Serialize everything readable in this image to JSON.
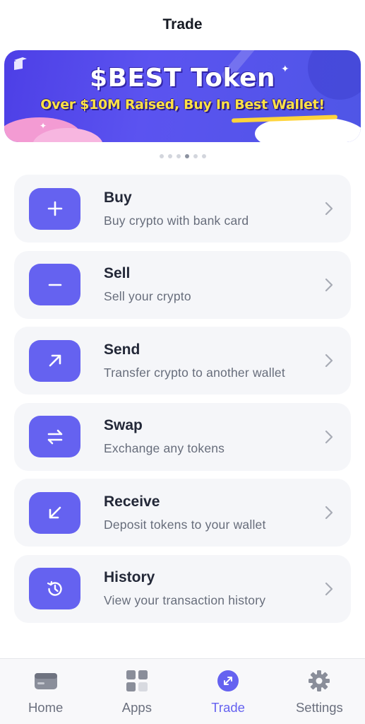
{
  "header": {
    "title": "Trade"
  },
  "banner": {
    "title": "$BEST Token",
    "subtitle": "Over $10M Raised, Buy In Best Wallet!",
    "dots": {
      "count": 6,
      "active_index": 3
    }
  },
  "menu": [
    {
      "label": "Buy",
      "desc": "Buy crypto with bank card",
      "icon": "plus-icon"
    },
    {
      "label": "Sell",
      "desc": "Sell your crypto",
      "icon": "minus-icon"
    },
    {
      "label": "Send",
      "desc": "Transfer crypto to another wallet",
      "icon": "arrow-up-right-icon"
    },
    {
      "label": "Swap",
      "desc": "Exchange any tokens",
      "icon": "swap-arrows-icon"
    },
    {
      "label": "Receive",
      "desc": "Deposit tokens to your wallet",
      "icon": "arrow-down-left-icon"
    },
    {
      "label": "History",
      "desc": "View your transaction history",
      "icon": "history-clock-icon"
    }
  ],
  "tabbar": {
    "tabs": [
      {
        "label": "Home",
        "icon": "wallet-card-icon",
        "active": false
      },
      {
        "label": "Apps",
        "icon": "apps-grid-icon",
        "active": false
      },
      {
        "label": "Trade",
        "icon": "trade-arrows-icon",
        "active": true
      },
      {
        "label": "Settings",
        "icon": "gear-icon",
        "active": false
      }
    ]
  },
  "colors": {
    "accent": "#6562f0",
    "card_bg": "#f5f6f9",
    "banner_bg": "#5b53f0",
    "banner_subtitle": "#ffe245"
  }
}
